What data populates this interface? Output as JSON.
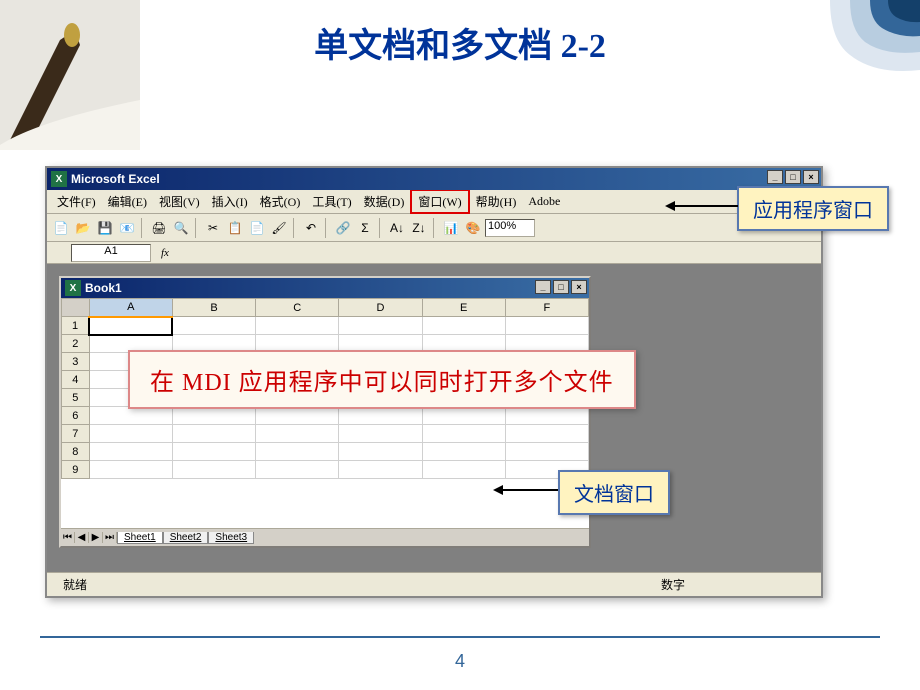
{
  "title": "单文档和多文档 2-2",
  "app_title": "Microsoft Excel",
  "menus": [
    "文件(F)",
    "编辑(E)",
    "视图(V)",
    "插入(I)",
    "格式(O)",
    "工具(T)",
    "数据(D)",
    "窗口(W)",
    "帮助(H)",
    "Adobe"
  ],
  "highlighted_menu_index": 7,
  "zoom": "100%",
  "namebox": "A1",
  "fx_label": "fx",
  "child_title": "Book1",
  "columns": [
    "A",
    "B",
    "C",
    "D",
    "E",
    "F"
  ],
  "rows": [
    "1",
    "2",
    "3",
    "4",
    "5",
    "6",
    "7",
    "8",
    "9"
  ],
  "sheets": [
    "Sheet1",
    "Sheet2",
    "Sheet3"
  ],
  "status_left": "就绪",
  "status_right": "数字",
  "callouts": {
    "app_window": "应用程序窗口",
    "doc_window": "文档窗口",
    "mdi_note": "在 MDI 应用程序中可以同时打开多个文件"
  },
  "page_number": "4"
}
